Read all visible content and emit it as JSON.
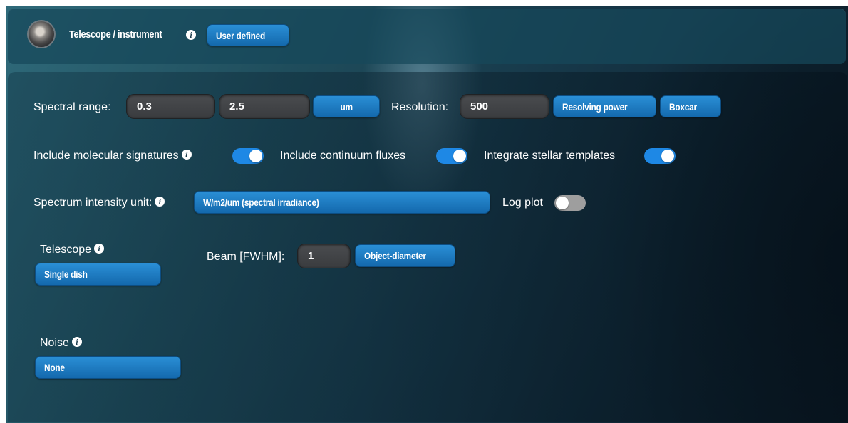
{
  "header": {
    "title": "Telescope / instrument",
    "mode_button": "User defined"
  },
  "spectral": {
    "label": "Spectral range:",
    "min": "0.3",
    "max": "2.5",
    "unit_button": "um",
    "resolution_label": "Resolution:",
    "resolution_value": "500",
    "resolution_type_button": "Resolving power",
    "kernel_button": "Boxcar"
  },
  "toggles": [
    {
      "label": "Include molecular signatures",
      "on": true
    },
    {
      "label": "Include continuum fluxes",
      "on": true
    },
    {
      "label": "Integrate stellar templates",
      "on": true
    }
  ],
  "intensity": {
    "label": "Spectrum intensity unit:",
    "value": "W/m2/um (spectral irradiance)",
    "log_plot_label": "Log plot",
    "log_plot_on": false
  },
  "telescope": {
    "label": "Telescope",
    "value": "Single dish",
    "beam_label": "Beam [FWHM]:",
    "beam_value": "1",
    "beam_unit_button": "Object-diameter"
  },
  "noise": {
    "label": "Noise",
    "value": "None"
  },
  "colors": {
    "button_blue": "#1e7fc8",
    "toggle_on": "#1e88e5",
    "toggle_off": "#9e9e9e"
  },
  "icons": {
    "info": "info-circle-icon",
    "avatar": "astronaut-avatar"
  }
}
